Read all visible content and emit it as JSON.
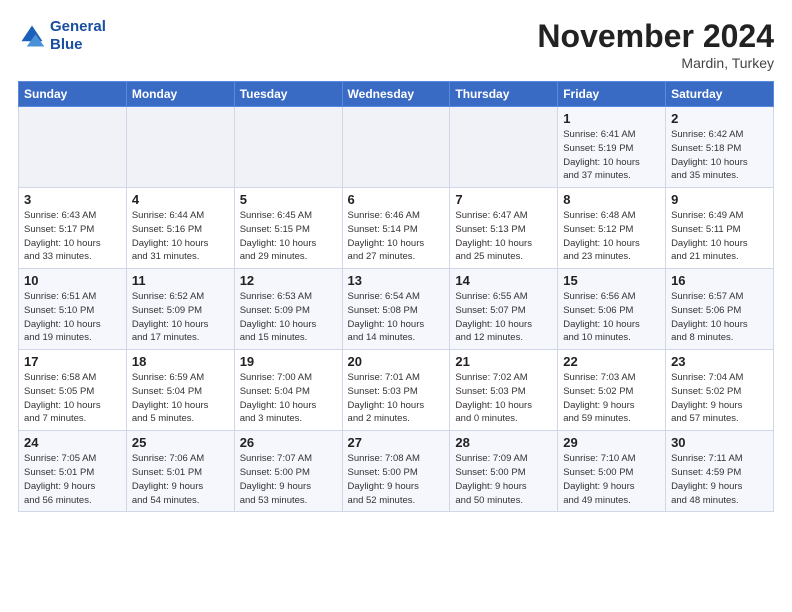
{
  "header": {
    "logo_line1": "General",
    "logo_line2": "Blue",
    "month": "November 2024",
    "location": "Mardin, Turkey"
  },
  "columns": [
    "Sunday",
    "Monday",
    "Tuesday",
    "Wednesday",
    "Thursday",
    "Friday",
    "Saturday"
  ],
  "weeks": [
    [
      {
        "day": "",
        "info": ""
      },
      {
        "day": "",
        "info": ""
      },
      {
        "day": "",
        "info": ""
      },
      {
        "day": "",
        "info": ""
      },
      {
        "day": "",
        "info": ""
      },
      {
        "day": "1",
        "info": "Sunrise: 6:41 AM\nSunset: 5:19 PM\nDaylight: 10 hours\nand 37 minutes."
      },
      {
        "day": "2",
        "info": "Sunrise: 6:42 AM\nSunset: 5:18 PM\nDaylight: 10 hours\nand 35 minutes."
      }
    ],
    [
      {
        "day": "3",
        "info": "Sunrise: 6:43 AM\nSunset: 5:17 PM\nDaylight: 10 hours\nand 33 minutes."
      },
      {
        "day": "4",
        "info": "Sunrise: 6:44 AM\nSunset: 5:16 PM\nDaylight: 10 hours\nand 31 minutes."
      },
      {
        "day": "5",
        "info": "Sunrise: 6:45 AM\nSunset: 5:15 PM\nDaylight: 10 hours\nand 29 minutes."
      },
      {
        "day": "6",
        "info": "Sunrise: 6:46 AM\nSunset: 5:14 PM\nDaylight: 10 hours\nand 27 minutes."
      },
      {
        "day": "7",
        "info": "Sunrise: 6:47 AM\nSunset: 5:13 PM\nDaylight: 10 hours\nand 25 minutes."
      },
      {
        "day": "8",
        "info": "Sunrise: 6:48 AM\nSunset: 5:12 PM\nDaylight: 10 hours\nand 23 minutes."
      },
      {
        "day": "9",
        "info": "Sunrise: 6:49 AM\nSunset: 5:11 PM\nDaylight: 10 hours\nand 21 minutes."
      }
    ],
    [
      {
        "day": "10",
        "info": "Sunrise: 6:51 AM\nSunset: 5:10 PM\nDaylight: 10 hours\nand 19 minutes."
      },
      {
        "day": "11",
        "info": "Sunrise: 6:52 AM\nSunset: 5:09 PM\nDaylight: 10 hours\nand 17 minutes."
      },
      {
        "day": "12",
        "info": "Sunrise: 6:53 AM\nSunset: 5:09 PM\nDaylight: 10 hours\nand 15 minutes."
      },
      {
        "day": "13",
        "info": "Sunrise: 6:54 AM\nSunset: 5:08 PM\nDaylight: 10 hours\nand 14 minutes."
      },
      {
        "day": "14",
        "info": "Sunrise: 6:55 AM\nSunset: 5:07 PM\nDaylight: 10 hours\nand 12 minutes."
      },
      {
        "day": "15",
        "info": "Sunrise: 6:56 AM\nSunset: 5:06 PM\nDaylight: 10 hours\nand 10 minutes."
      },
      {
        "day": "16",
        "info": "Sunrise: 6:57 AM\nSunset: 5:06 PM\nDaylight: 10 hours\nand 8 minutes."
      }
    ],
    [
      {
        "day": "17",
        "info": "Sunrise: 6:58 AM\nSunset: 5:05 PM\nDaylight: 10 hours\nand 7 minutes."
      },
      {
        "day": "18",
        "info": "Sunrise: 6:59 AM\nSunset: 5:04 PM\nDaylight: 10 hours\nand 5 minutes."
      },
      {
        "day": "19",
        "info": "Sunrise: 7:00 AM\nSunset: 5:04 PM\nDaylight: 10 hours\nand 3 minutes."
      },
      {
        "day": "20",
        "info": "Sunrise: 7:01 AM\nSunset: 5:03 PM\nDaylight: 10 hours\nand 2 minutes."
      },
      {
        "day": "21",
        "info": "Sunrise: 7:02 AM\nSunset: 5:03 PM\nDaylight: 10 hours\nand 0 minutes."
      },
      {
        "day": "22",
        "info": "Sunrise: 7:03 AM\nSunset: 5:02 PM\nDaylight: 9 hours\nand 59 minutes."
      },
      {
        "day": "23",
        "info": "Sunrise: 7:04 AM\nSunset: 5:02 PM\nDaylight: 9 hours\nand 57 minutes."
      }
    ],
    [
      {
        "day": "24",
        "info": "Sunrise: 7:05 AM\nSunset: 5:01 PM\nDaylight: 9 hours\nand 56 minutes."
      },
      {
        "day": "25",
        "info": "Sunrise: 7:06 AM\nSunset: 5:01 PM\nDaylight: 9 hours\nand 54 minutes."
      },
      {
        "day": "26",
        "info": "Sunrise: 7:07 AM\nSunset: 5:00 PM\nDaylight: 9 hours\nand 53 minutes."
      },
      {
        "day": "27",
        "info": "Sunrise: 7:08 AM\nSunset: 5:00 PM\nDaylight: 9 hours\nand 52 minutes."
      },
      {
        "day": "28",
        "info": "Sunrise: 7:09 AM\nSunset: 5:00 PM\nDaylight: 9 hours\nand 50 minutes."
      },
      {
        "day": "29",
        "info": "Sunrise: 7:10 AM\nSunset: 5:00 PM\nDaylight: 9 hours\nand 49 minutes."
      },
      {
        "day": "30",
        "info": "Sunrise: 7:11 AM\nSunset: 4:59 PM\nDaylight: 9 hours\nand 48 minutes."
      }
    ]
  ]
}
